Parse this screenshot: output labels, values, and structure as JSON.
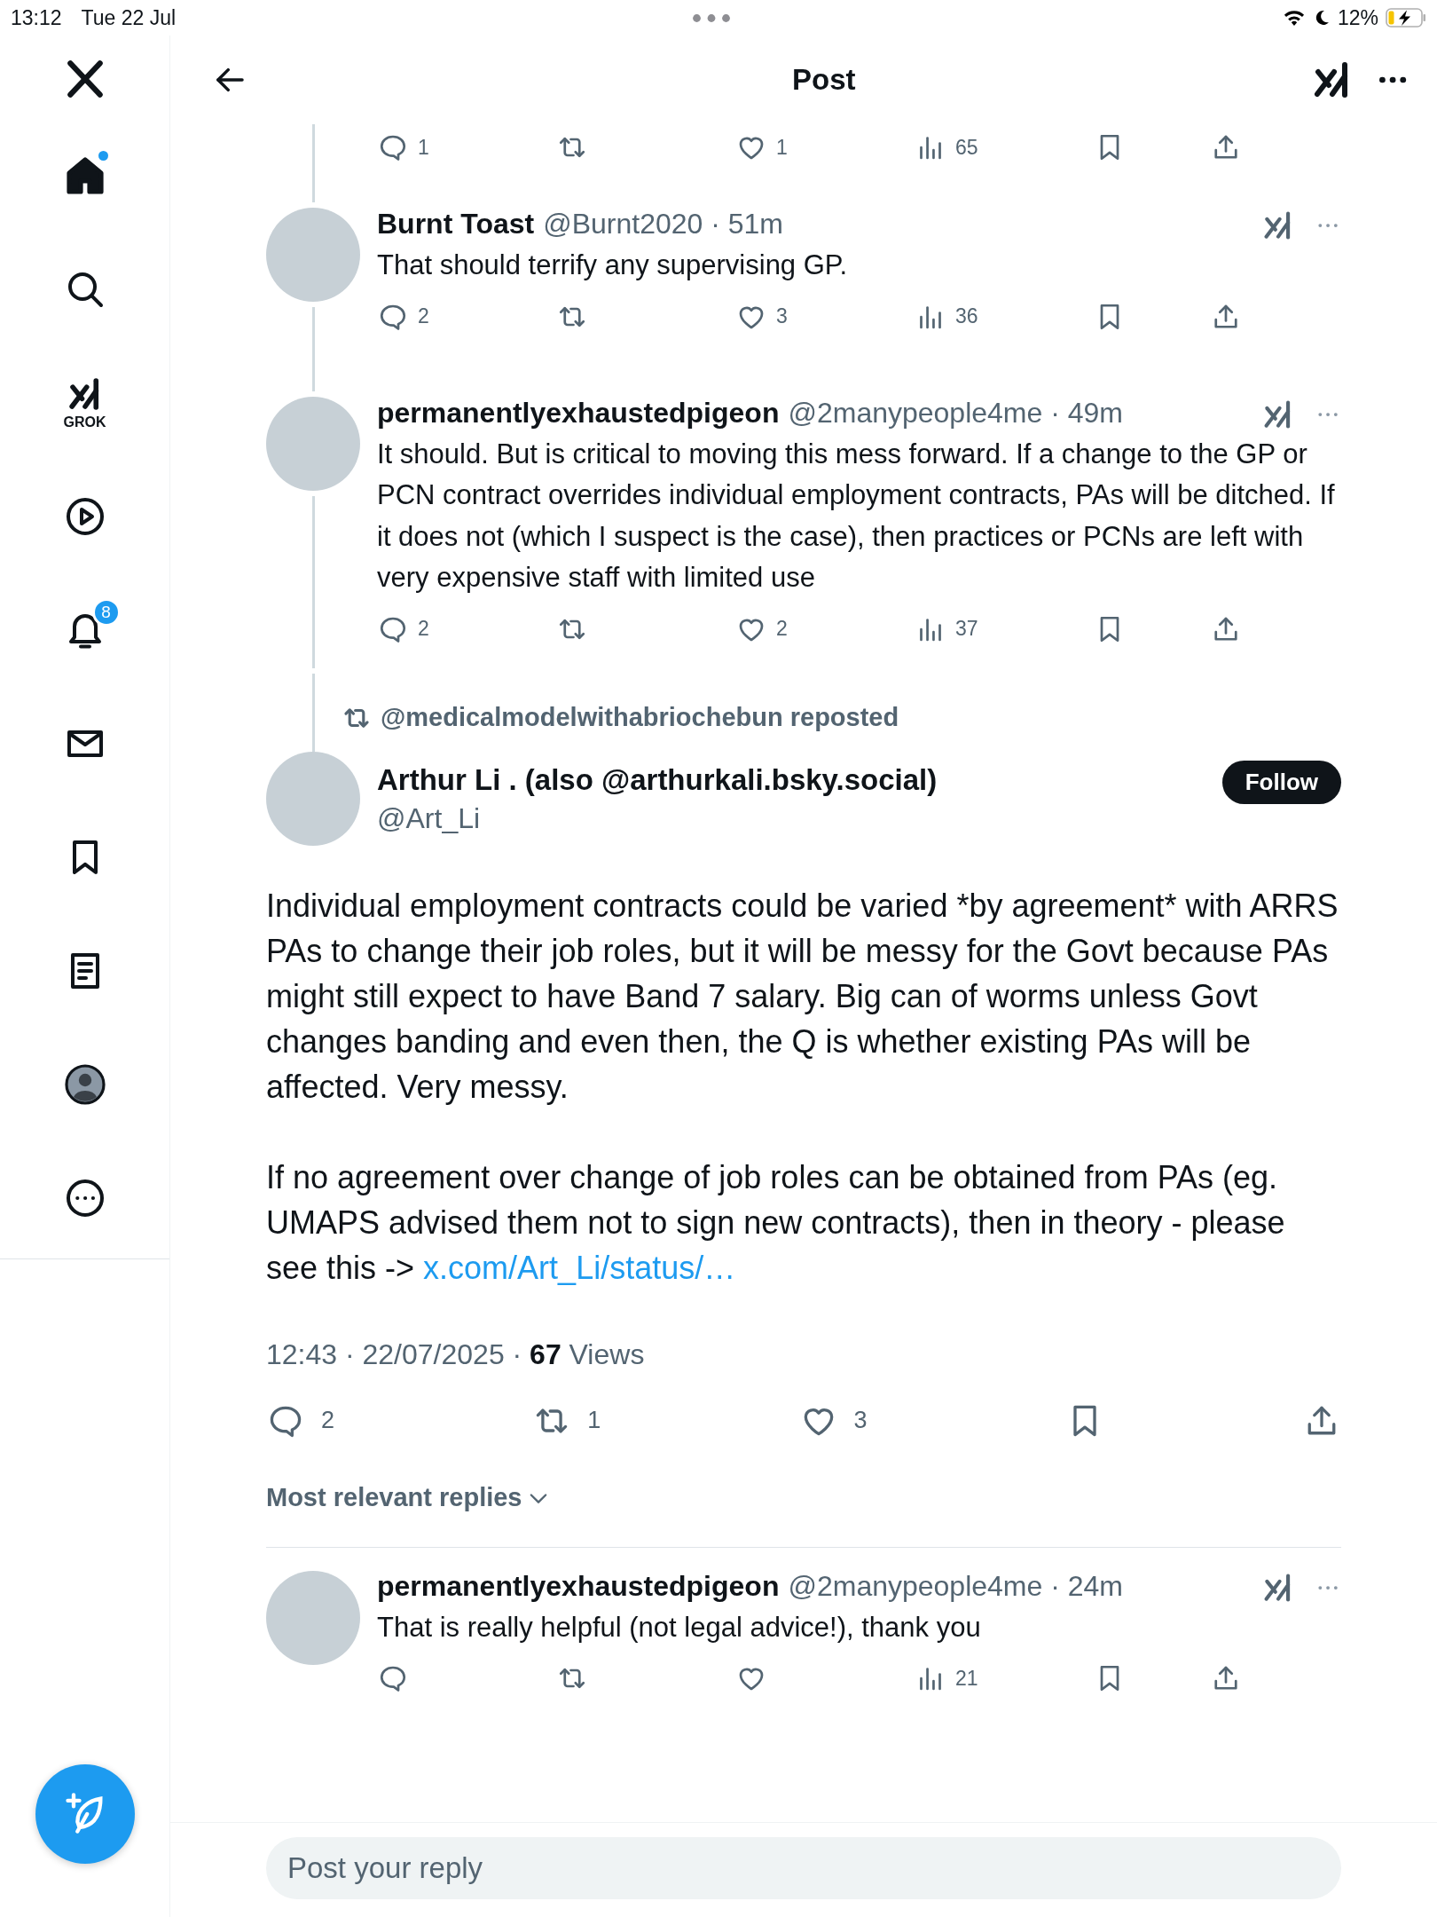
{
  "status_bar": {
    "time": "13:12",
    "date": "Tue 22 Jul",
    "battery": "12%"
  },
  "sidebar": {
    "items": [
      {
        "kind": "home",
        "selected": true,
        "unread": true
      },
      {
        "kind": "search",
        "selected": false,
        "unread": false
      },
      {
        "kind": "grok",
        "label": "GROK",
        "selected": false,
        "unread": false
      },
      {
        "kind": "video",
        "selected": false,
        "unread": false
      },
      {
        "kind": "notifications",
        "badge": "8",
        "selected": false,
        "unread": false
      },
      {
        "kind": "messages",
        "selected": false,
        "unread": false
      },
      {
        "kind": "bookmarks",
        "selected": false,
        "unread": false
      },
      {
        "kind": "lists",
        "selected": false,
        "unread": false
      },
      {
        "kind": "profile",
        "selected": false,
        "unread": false
      },
      {
        "kind": "more",
        "selected": false,
        "unread": false
      }
    ]
  },
  "header": {
    "title": "Post"
  },
  "thread_top_actions": [
    {
      "kind": "reply",
      "count": "1"
    },
    {
      "kind": "repost"
    },
    {
      "kind": "like",
      "count": "1"
    },
    {
      "kind": "views",
      "count": "65"
    },
    {
      "kind": "bookmark"
    },
    {
      "kind": "share"
    }
  ],
  "thread_replies": [
    {
      "name": "Burnt Toast",
      "meta": "@Burnt2020 · 51m",
      "text": "That should terrify any supervising GP.",
      "actions": [
        {
          "kind": "reply",
          "count": "2"
        },
        {
          "kind": "repost"
        },
        {
          "kind": "like",
          "count": "3"
        },
        {
          "kind": "views",
          "count": "36"
        },
        {
          "kind": "bookmark"
        },
        {
          "kind": "share"
        }
      ]
    },
    {
      "name": "permanentlyexhaustedpigeon",
      "meta": "@2manypeople4me · 49m",
      "text": "It should. But is critical to moving this mess forward. If a change to the GP or PCN contract overrides individual employment contracts, PAs will be ditched. If it does not (which I suspect is the case), then practices or PCNs are left with very expensive staff with limited use",
      "actions": [
        {
          "kind": "reply",
          "count": "2"
        },
        {
          "kind": "repost"
        },
        {
          "kind": "like",
          "count": "2"
        },
        {
          "kind": "views",
          "count": "37"
        },
        {
          "kind": "bookmark"
        },
        {
          "kind": "share"
        }
      ]
    }
  ],
  "repost_banner": "@medicalmodelwithabriochebun reposted",
  "post": {
    "name": "Arthur Li . (also @arthurkali.bsky.social)",
    "handle": "@Art_Li",
    "follow_button": "Follow",
    "paragraphs": [
      {
        "text": "Individual employment contracts could be varied *by agreement* with ARRS PAs to change their job roles, but it will be messy for the Govt because PAs might still expect to have Band 7 salary. Big can of worms unless Govt changes banding and even then, the Q is whether existing PAs will be affected. Very messy."
      },
      {
        "text": "If no agreement over change of job roles can be obtained from PAs (eg. UMAPS advised them not to sign new contracts), then in theory - please see this ->",
        "link": "x.com/Art_Li/status/…"
      }
    ],
    "timestamp": "12:43 · 22/07/2025 · **67** Views",
    "actions": [
      {
        "kind": "reply",
        "count": "2"
      },
      {
        "kind": "repost",
        "count": "1"
      },
      {
        "kind": "like",
        "count": "3"
      },
      {
        "kind": "bookmark"
      },
      {
        "kind": "share"
      }
    ]
  },
  "sort": "Most relevant replies",
  "replies": [
    {
      "name": "permanentlyexhaustedpigeon",
      "meta": "@2manypeople4me · 24m",
      "text": "That is really helpful (not legal advice!), thank you",
      "actions": [
        {
          "kind": "reply"
        },
        {
          "kind": "repost"
        },
        {
          "kind": "like"
        },
        {
          "kind": "views",
          "count": "21"
        },
        {
          "kind": "bookmark"
        },
        {
          "kind": "share"
        }
      ]
    }
  ],
  "reply_box": {
    "placeholder": "Post your reply"
  }
}
